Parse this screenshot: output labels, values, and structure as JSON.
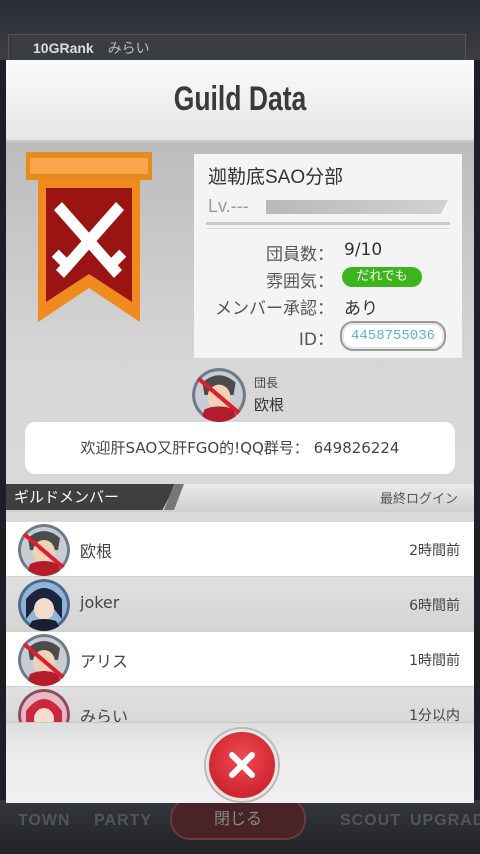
{
  "background": {
    "rank_label": "10GRank",
    "player_name": "みらい",
    "close_label": "閉じる",
    "nav_items": [
      "TOWN",
      "PARTY",
      "SCOUT",
      "UPGRADE"
    ]
  },
  "modal": {
    "title": "Guild Data",
    "guild": {
      "name": "迦勒底SAO分部",
      "level_label": "Lv.---",
      "member_count_label": "団員数：",
      "member_count_value": "9/10",
      "atmosphere_label": "雰囲気：",
      "atmosphere_value": "だれでも",
      "approval_label": "メンバー承認：",
      "approval_value": "あり",
      "id_label": "ID：",
      "id_value": "4458755036"
    },
    "leader": {
      "role": "団長",
      "name": "欧根"
    },
    "message": "欢迎肝SAO又肝FGO的!QQ群号： 649826224",
    "members_section": {
      "tab_label": "ギルドメンバー",
      "sort_label": "最終ログイン",
      "members": [
        {
          "name": "欧根",
          "last_login": "2時間前"
        },
        {
          "name": "joker",
          "last_login": "6時間前"
        },
        {
          "name": "アリス",
          "last_login": "1時間前"
        },
        {
          "name": "みらい",
          "last_login": "1分以内"
        }
      ]
    },
    "close_icon": "close-x-icon",
    "colors": {
      "banner_orange": "#f08a1e",
      "emblem_red": "#9b1414",
      "green_pill": "#3cb51c",
      "close_red": "#d9313b",
      "id_text": "#5bb8c6"
    }
  }
}
